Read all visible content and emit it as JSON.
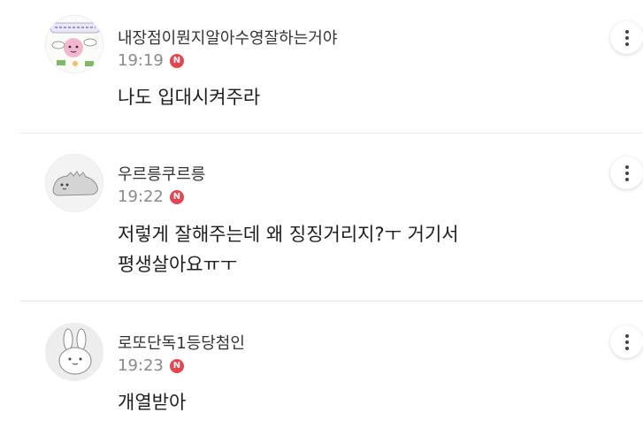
{
  "comments": [
    {
      "nickname": "내장점이뭔지알아수영잘하는거야",
      "time": "19:19",
      "badge": "N",
      "text_lines": [
        "나도 입대시켜주라"
      ],
      "avatar_icon": "pink-character-sticker-icon"
    },
    {
      "nickname": "우르릉쿠르릉",
      "time": "19:22",
      "badge": "N",
      "text_lines": [
        "저렇게 잘해주는데 왜 징징거리지?ㅜ 거기서",
        "평생살아요ㅠㅜ"
      ],
      "avatar_icon": "gray-dinosaur-icon"
    },
    {
      "nickname": "로또단독1등당첨인",
      "time": "19:23",
      "badge": "N",
      "text_lines": [
        "개열받아"
      ],
      "avatar_icon": "white-rabbit-icon"
    }
  ],
  "colors": {
    "badge": "#e8444f",
    "time": "#8a8a8a",
    "divider": "#e9e9e9"
  }
}
